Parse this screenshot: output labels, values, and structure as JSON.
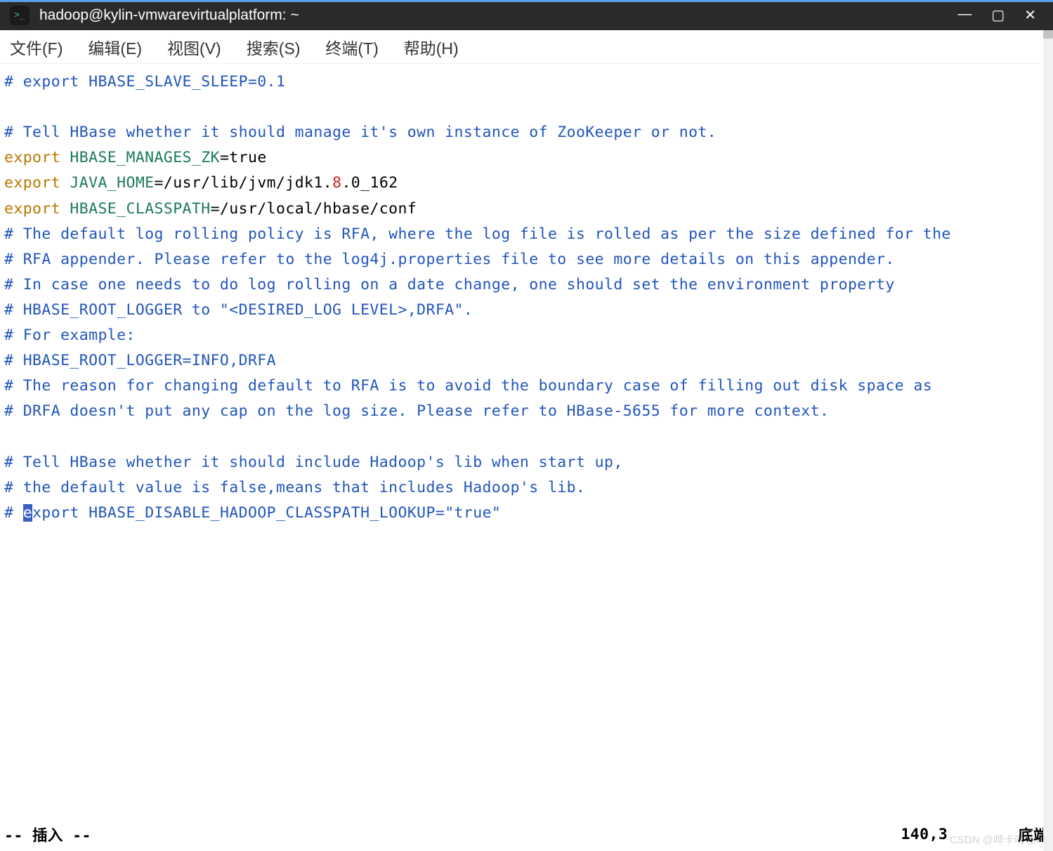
{
  "window": {
    "title": "hadoop@kylin-vmwarevirtualplatform: ~",
    "icon_symbol": ">_"
  },
  "menu": {
    "file": "文件(F)",
    "edit": "编辑(E)",
    "view": "视图(V)",
    "search": "搜索(S)",
    "terminal": "终端(T)",
    "help": "帮助(H)"
  },
  "code": {
    "l1": "# export HBASE_SLAVE_SLEEP=0.1",
    "l2": "",
    "l3": "# Tell HBase whether it should manage it's own instance of ZooKeeper or not.",
    "l4a": "export",
    "l4b": " HBASE_MANAGES_ZK",
    "l4c": "=true",
    "l5a": "export",
    "l5b": " JAVA_HOME",
    "l5c": "=/usr/lib/jvm/jdk1.",
    "l5d": "8",
    "l5e": ".0_162",
    "l6a": "export",
    "l6b": " HBASE_CLASSPATH",
    "l6c": "=/usr/local/hbase/conf",
    "l7": "# The default log rolling policy is RFA, where the log file is rolled as per the size defined for the",
    "l8": "# RFA appender. Please refer to the log4j.properties file to see more details on this appender.",
    "l9": "# In case one needs to do log rolling on a date change, one should set the environment property",
    "l10": "# HBASE_ROOT_LOGGER to \"<DESIRED_LOG LEVEL>,DRFA\".",
    "l11": "# For example:",
    "l12": "# HBASE_ROOT_LOGGER=INFO,DRFA",
    "l13": "# The reason for changing default to RFA is to avoid the boundary case of filling out disk space as",
    "l14": "# DRFA doesn't put any cap on the log size. Please refer to HBase-5655 for more context.",
    "l15": "",
    "l16": "# Tell HBase whether it should include Hadoop's lib when start up,",
    "l17": "# the default value is false,means that includes Hadoop's lib.",
    "l18a": "# ",
    "l18b": "e",
    "l18c": "xport HBASE_DISABLE_HADOOP_CLASSPATH_LOOKUP=\"true\""
  },
  "status": {
    "mode": "-- 插入 --",
    "position": "140,3",
    "location": "底端"
  },
  "watermark": "CSDN @哗卡啦哇咔"
}
